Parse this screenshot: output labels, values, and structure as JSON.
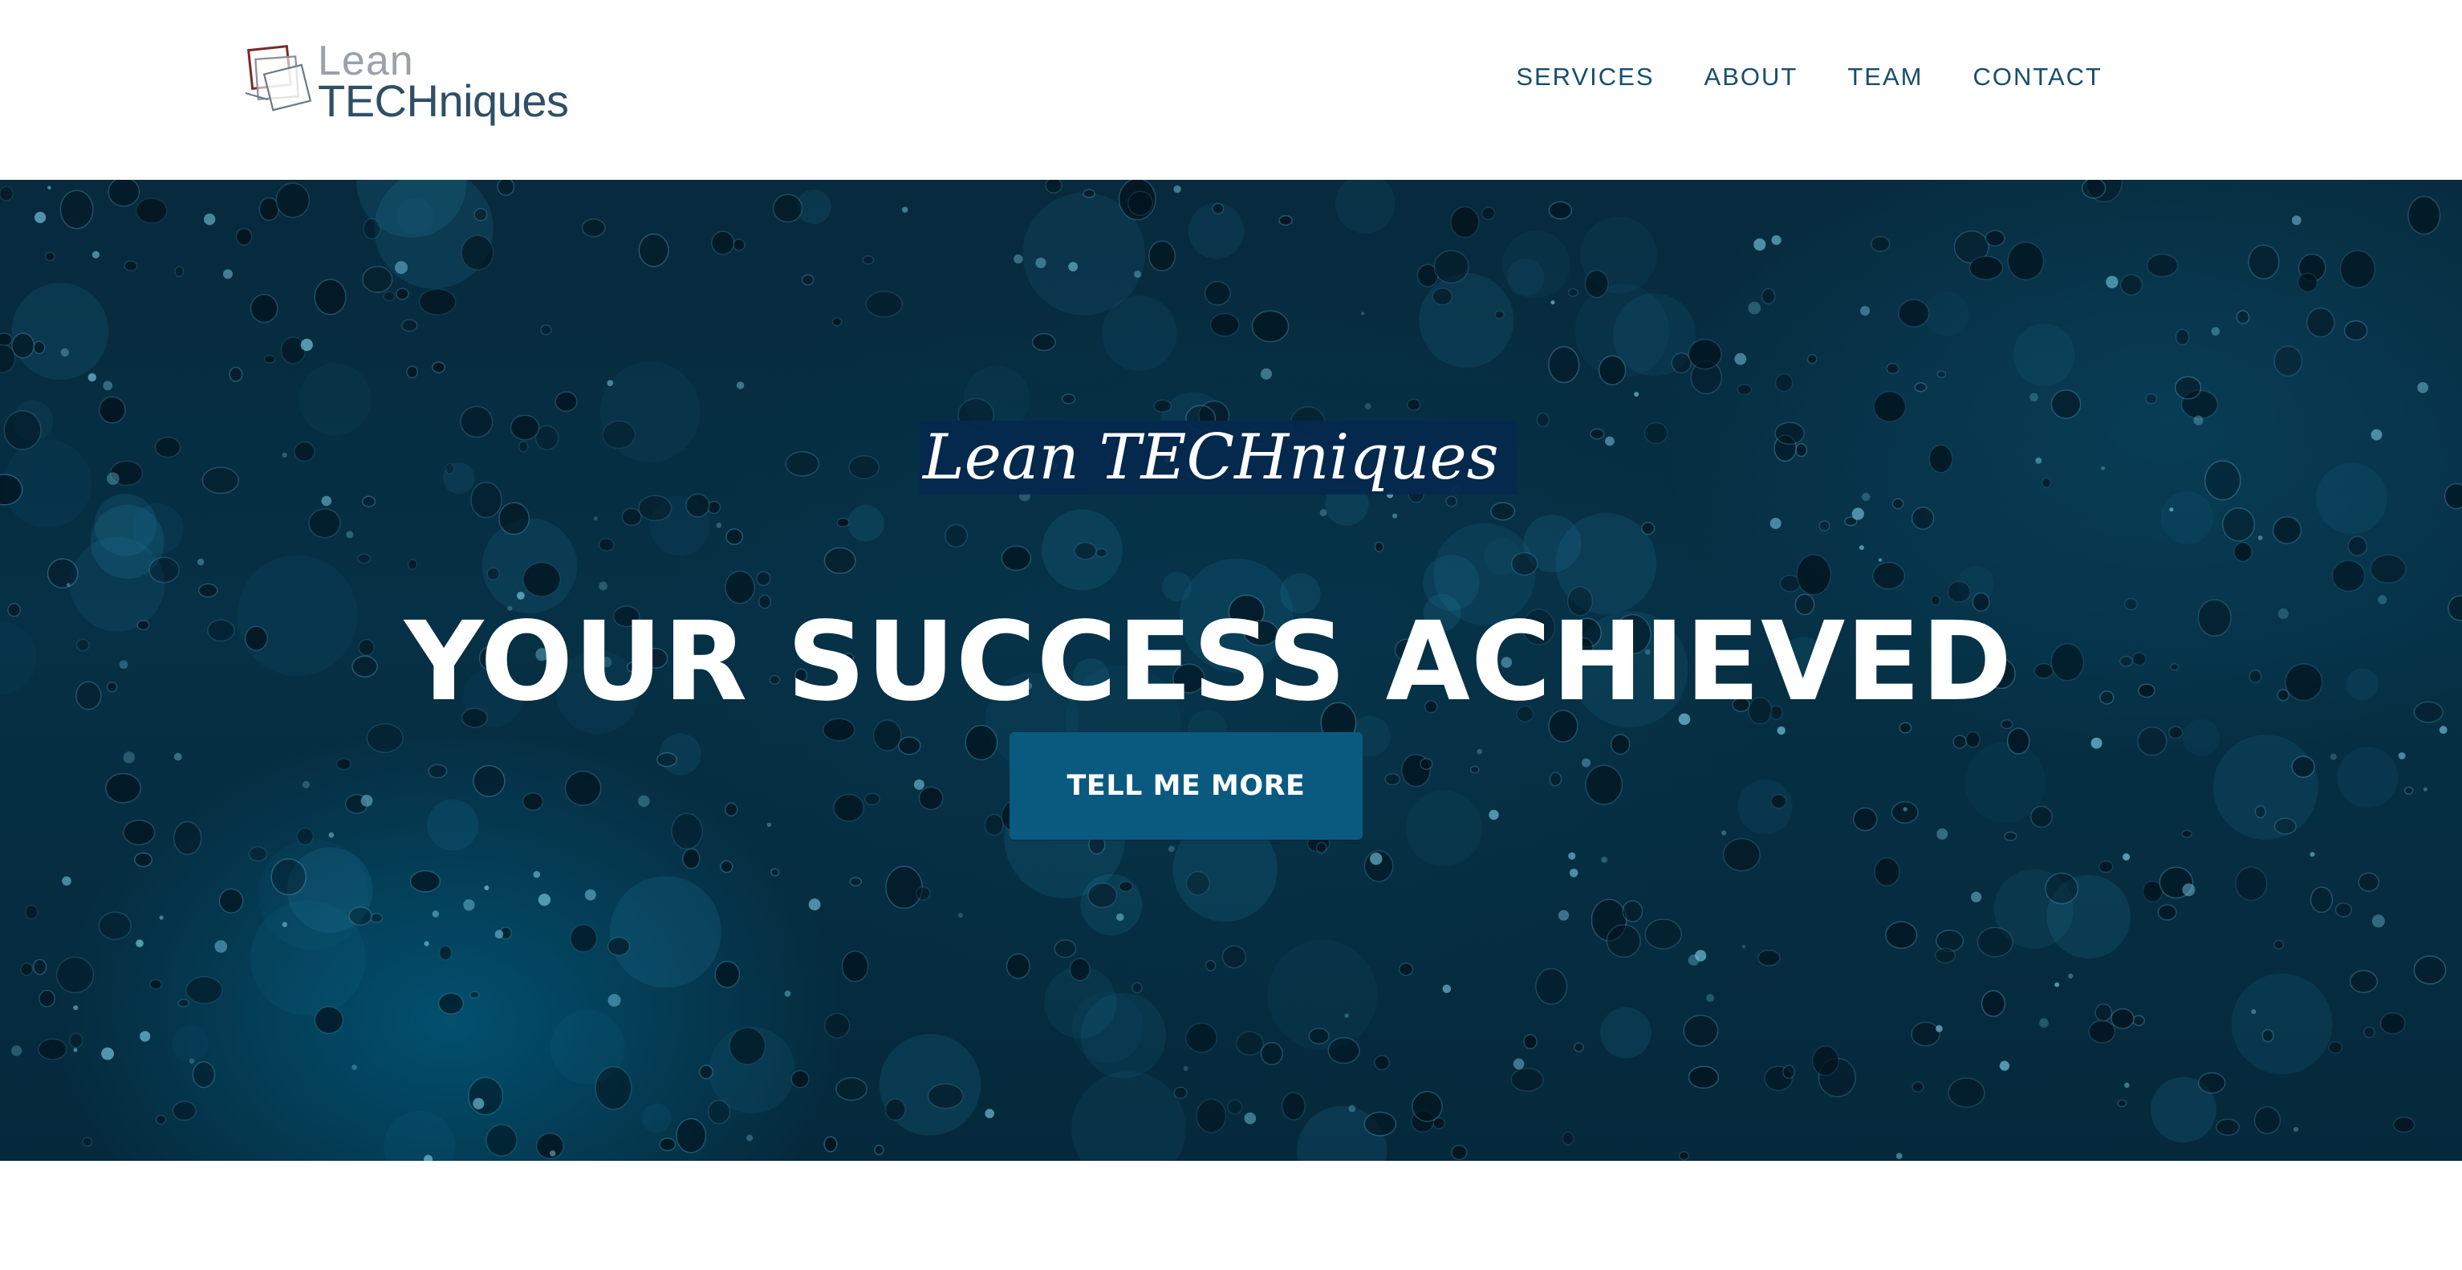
{
  "brand": {
    "logo_line1": "Lean",
    "logo_line2": "TECHniques",
    "colors": {
      "logo_light": "#9aa1a8",
      "logo_dark": "#2f4f66",
      "logo_mark_accent": "#7a2a2a"
    }
  },
  "nav": {
    "items": [
      {
        "label": "SERVICES"
      },
      {
        "label": "ABOUT"
      },
      {
        "label": "TEAM"
      },
      {
        "label": "CONTACT"
      }
    ],
    "color": "#164e6c"
  },
  "hero": {
    "tagline": "Lean TECHniques",
    "headline": "YOUR SUCCESS ACHIEVED",
    "cta_label": "TELL ME MORE",
    "colors": {
      "background": "#063045",
      "tagline_highlight": "#05284e",
      "cta": "#0a5a80",
      "text": "#ffffff"
    }
  }
}
